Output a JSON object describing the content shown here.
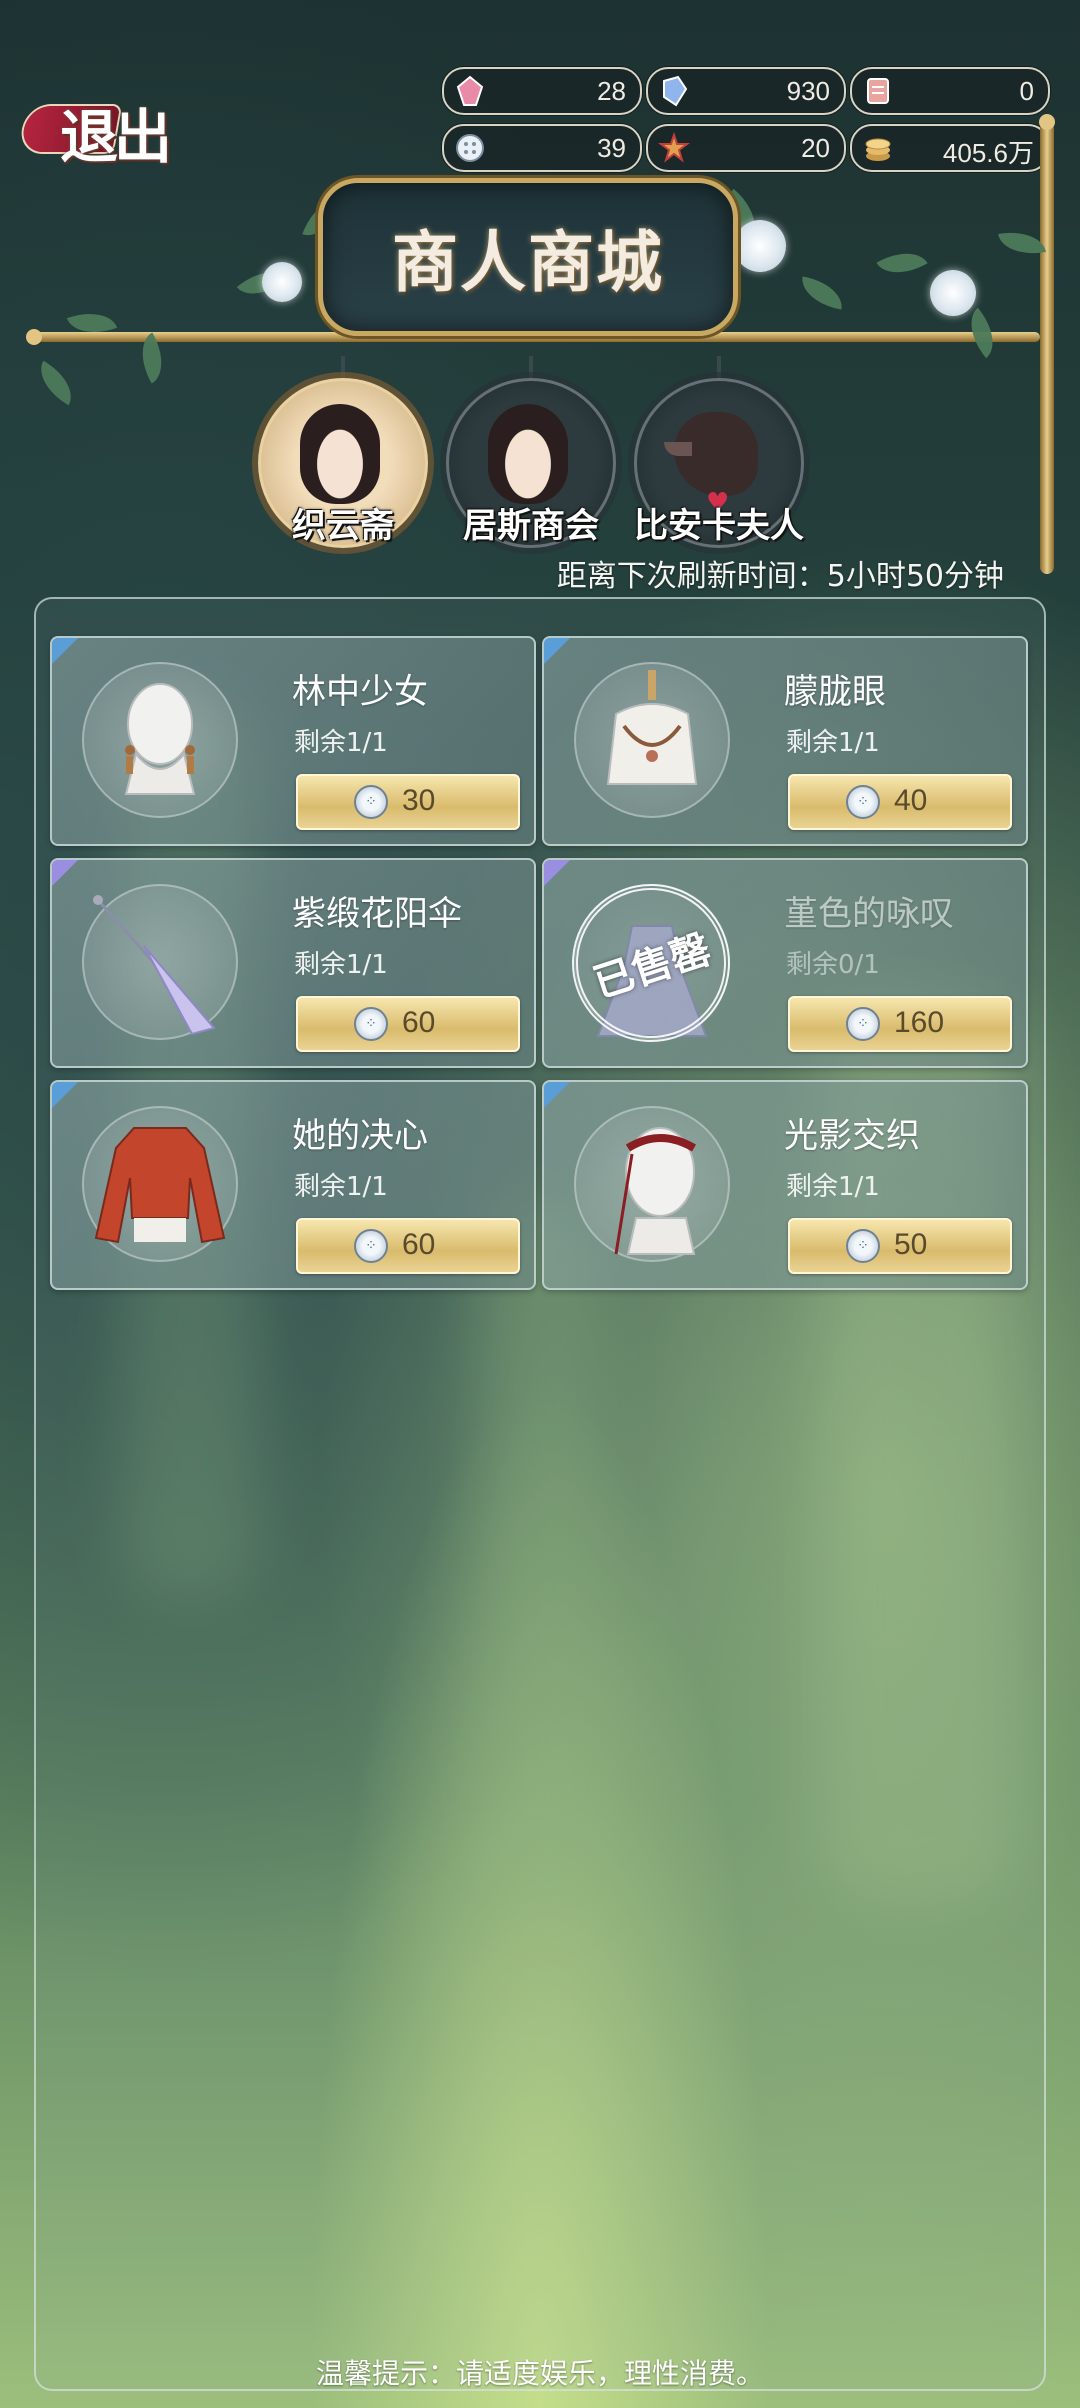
{
  "exit": {
    "label": "退出"
  },
  "currencies": [
    {
      "icon": "pink-crystal-icon",
      "value": "28"
    },
    {
      "icon": "blue-crystal-icon",
      "value": "930"
    },
    {
      "icon": "ticket-icon",
      "value": "0"
    },
    {
      "icon": "button-coin-icon",
      "value": "39"
    },
    {
      "icon": "star-badge-icon",
      "value": "20"
    },
    {
      "icon": "gold-coins-icon",
      "value": "405.6万"
    }
  ],
  "shop": {
    "title": "商人商城"
  },
  "merchants": [
    {
      "name": "织云斋",
      "active": true
    },
    {
      "name": "居斯商会",
      "active": false
    },
    {
      "name": "比安卡夫人",
      "active": false
    }
  ],
  "refresh_label": "距离下次刷新时间：5小时50分钟",
  "items": [
    {
      "name": "林中少女",
      "stock": "剩余1/1",
      "price": "30",
      "sold_out": false,
      "icon": "earrings-icon"
    },
    {
      "name": "朦胧眼",
      "stock": "剩余1/1",
      "price": "40",
      "sold_out": false,
      "icon": "necklace-icon"
    },
    {
      "name": "紫缎花阳伞",
      "stock": "剩余1/1",
      "price": "60",
      "sold_out": false,
      "icon": "parasol-icon"
    },
    {
      "name": "堇色的咏叹",
      "stock": "剩余0/1",
      "price": "160",
      "sold_out": true,
      "icon": "gown-icon",
      "sold_label": "已售罄"
    },
    {
      "name": "她的决心",
      "stock": "剩余1/1",
      "price": "60",
      "sold_out": false,
      "icon": "blouse-icon"
    },
    {
      "name": "光影交织",
      "stock": "剩余1/1",
      "price": "50",
      "sold_out": false,
      "icon": "headband-icon"
    }
  ],
  "tip": "温馨提示：请适度娱乐，理性消费。",
  "colors": {
    "accent_gold": "#d9bb6c",
    "tag_red": "#b5243f",
    "corner_blue": "#5a9ed8",
    "corner_purple": "#9a8ee0"
  }
}
